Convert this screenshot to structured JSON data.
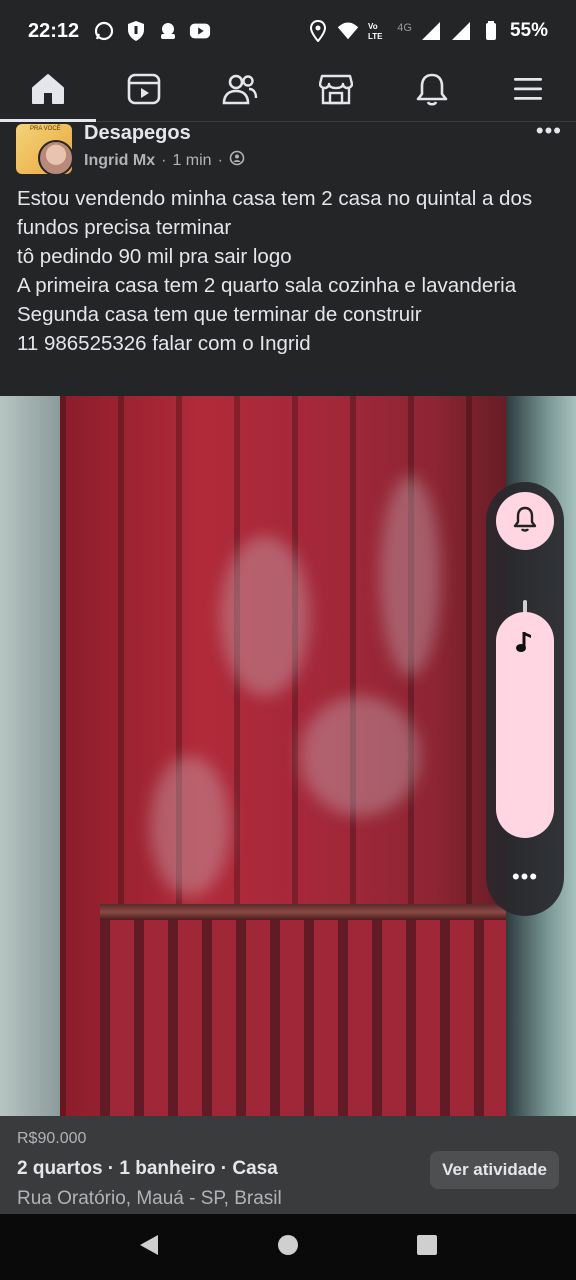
{
  "status_bar": {
    "time": "22:12",
    "network_label": "4G",
    "battery": "55%",
    "icons": [
      "whatsapp-icon",
      "shield-icon",
      "app-icon",
      "youtube-icon",
      "location-icon",
      "wifi-icon",
      "volte-icon",
      "signal-icon",
      "signal-icon",
      "battery-icon"
    ]
  },
  "nav": {
    "tabs": [
      {
        "name": "home",
        "icon": "home-icon",
        "active": true
      },
      {
        "name": "reels",
        "icon": "video-icon",
        "active": false
      },
      {
        "name": "friends",
        "icon": "friends-icon",
        "active": false
      },
      {
        "name": "marketplace",
        "icon": "store-icon",
        "active": false
      },
      {
        "name": "notifications",
        "icon": "bell-icon",
        "active": false
      },
      {
        "name": "menu",
        "icon": "hamburger-icon",
        "active": false
      }
    ]
  },
  "post": {
    "group_name": "Desapegos",
    "author": "Ingrid Mx",
    "time": "1 min",
    "separator": "·",
    "avatar_tiny_text": "PRA VOCÊ",
    "more_label": "•••",
    "text": "Estou vendendo minha casa tem 2 casa no quintal a dos fundos precisa terminar\n tô pedindo 90 mil pra sair logo\nA primeira casa tem 2 quarto sala cozinha e lavanderia\nSegunda casa tem que terminar de construir\n11 986525326 falar com o Ingrid"
  },
  "float_panel": {
    "more_label": "•••",
    "accent": "#ffd6e2"
  },
  "listing": {
    "price": "R$90.000",
    "details": "2 quartos · 1 banheiro · Casa",
    "location": "Rua Oratório, Mauá - SP, Brasil",
    "activity_button": "Ver atividade"
  },
  "colors": {
    "background": "#242526",
    "text": "#e4e6eb",
    "secondary_text": "#b0b3b8"
  }
}
